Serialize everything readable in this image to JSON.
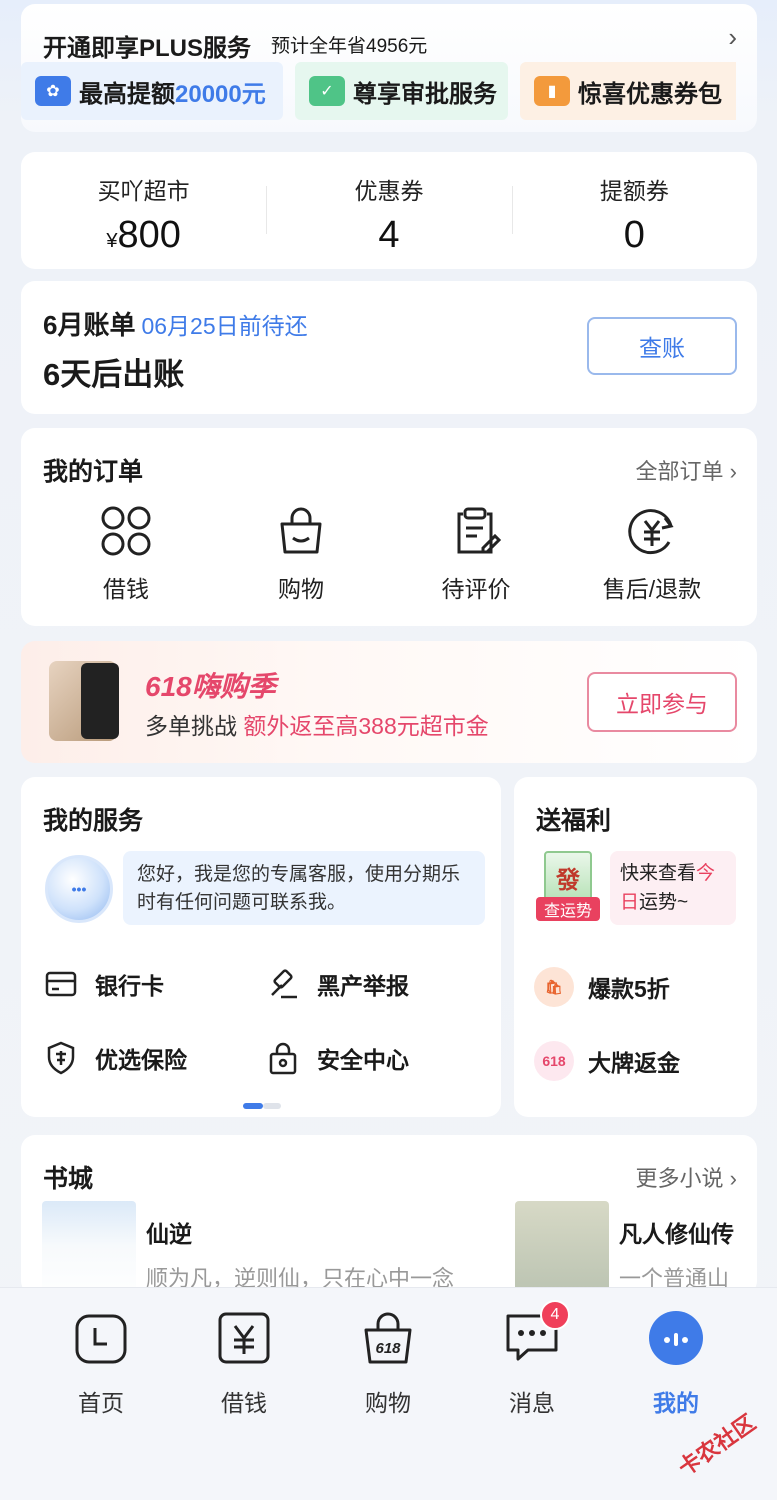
{
  "plus": {
    "title": "开通即享PLUS服务",
    "subtitle": "预计全年省4956元",
    "perks": [
      {
        "prefix": "最高提额",
        "highlight": "20000元",
        "icon": "quota-icon"
      },
      {
        "label": "尊享审批服务",
        "icon": "approval-icon"
      },
      {
        "label": "惊喜优惠券包",
        "icon": "coupon-icon"
      }
    ]
  },
  "stats": [
    {
      "label": "买吖超市",
      "currency": "¥",
      "value": "800"
    },
    {
      "label": "优惠券",
      "currency": "",
      "value": "4"
    },
    {
      "label": "提额券",
      "currency": "",
      "value": "0"
    }
  ],
  "bill": {
    "month": "6月账单",
    "due": "06月25日前待还",
    "status": "6天后出账",
    "button": "查账"
  },
  "orders": {
    "title": "我的订单",
    "more": "全部订单",
    "items": [
      {
        "label": "借钱",
        "icon": "clover-icon"
      },
      {
        "label": "购物",
        "icon": "shopping-bag-icon"
      },
      {
        "label": "待评价",
        "icon": "clipboard-edit-icon"
      },
      {
        "label": "售后/退款",
        "icon": "refund-icon"
      }
    ]
  },
  "promo": {
    "title": "618嗨购季",
    "text": "多单挑战",
    "highlight": "额外返至高388元超市金",
    "button": "立即参与"
  },
  "services": {
    "title": "我的服务",
    "bot_text": "您好，我是您的专属客服，使用分期乐时有任何问题可联系我。",
    "items": [
      {
        "label": "银行卡",
        "icon": "bank-card-icon"
      },
      {
        "label": "黑产举报",
        "icon": "gavel-icon"
      },
      {
        "label": "优选保险",
        "icon": "insurance-shield-icon"
      },
      {
        "label": "安全中心",
        "icon": "lock-icon"
      }
    ]
  },
  "benefits": {
    "title": "送福利",
    "fortune_tile": "發",
    "fortune_tag": "查运势",
    "fortune_prefix": "快来查看",
    "fortune_highlight": "今日",
    "fortune_suffix": "运势~",
    "items": [
      {
        "label": "爆款5折",
        "icon": "hot-deal-icon"
      },
      {
        "label": "大牌返金",
        "icon": "618-icon",
        "icon_text": "618"
      }
    ]
  },
  "books": {
    "title": "书城",
    "more": "更多小说",
    "items": [
      {
        "name": "仙逆",
        "desc": "顺为凡，逆则仙，只在心中一念"
      },
      {
        "name": "凡人修仙传",
        "desc": "一个普通山"
      }
    ]
  },
  "tabs": [
    {
      "label": "首页",
      "icon": "home-clock-icon"
    },
    {
      "label": "借钱",
      "icon": "yen-icon"
    },
    {
      "label": "购物",
      "icon": "618-bag-icon"
    },
    {
      "label": "消息",
      "icon": "chat-icon",
      "badge": "4"
    },
    {
      "label": "我的",
      "icon": "profile-icon"
    }
  ],
  "tab_icon_text": {
    "shopping": "618"
  },
  "watermark": "卡农社区",
  "colors": {
    "accent": "#3f7be8",
    "promo": "#e5476b",
    "badge": "#f0405a"
  }
}
